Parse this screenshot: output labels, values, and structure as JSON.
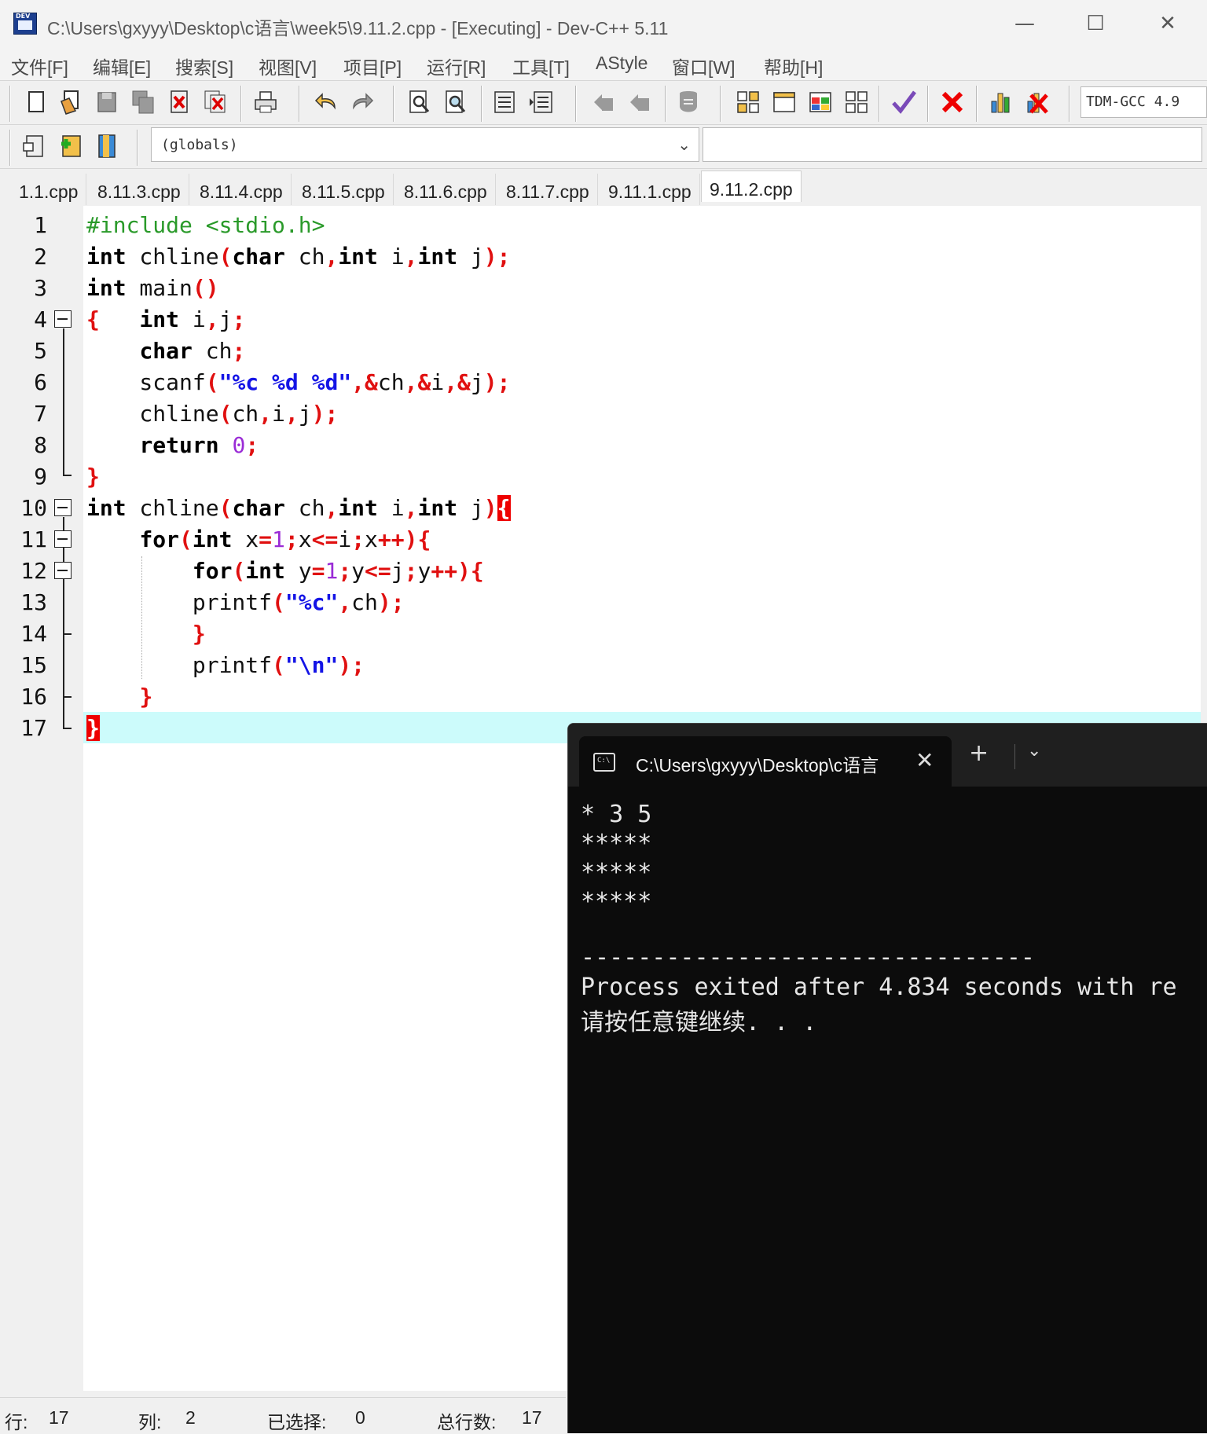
{
  "window": {
    "title": "C:\\Users\\gxyyy\\Desktop\\c语言\\week5\\9.11.2.cpp - [Executing] - Dev-C++ 5.11",
    "minimize": "—",
    "maximize": "☐",
    "close": "✕"
  },
  "menu": [
    "文件[F]",
    "编辑[E]",
    "搜索[S]",
    "视图[V]",
    "项目[P]",
    "运行[R]",
    "工具[T]",
    "AStyle",
    "窗口[W]",
    "帮助[H]"
  ],
  "toolbar": {
    "compiler": "TDM-GCC 4.9",
    "scope_combo": "(globals)"
  },
  "tabs": [
    "1.1.cpp",
    "8.11.3.cpp",
    "8.11.4.cpp",
    "8.11.5.cpp",
    "8.11.6.cpp",
    "8.11.7.cpp",
    "9.11.1.cpp",
    "9.11.2.cpp"
  ],
  "active_tab": "9.11.2.cpp",
  "editor": {
    "line_numbers": [
      "1",
      "2",
      "3",
      "4",
      "5",
      "6",
      "7",
      "8",
      "9",
      "10",
      "11",
      "12",
      "13",
      "14",
      "15",
      "16",
      "17"
    ],
    "lines": [
      "#include <stdio.h>",
      "int chline(char ch,int i,int j);",
      "int main()",
      "{   int i,j;",
      "    char ch;",
      "    scanf(\"%c %d %d\",&ch,&i,&j);",
      "    chline(ch,i,j);",
      "    return 0;",
      "}",
      "int chline(char ch,int i,int j){",
      "    for(int x=1;x<=i;x++){",
      "        for(int y=1;y<=j;y++){",
      "        printf(\"%c\",ch);",
      "        }",
      "        printf(\"\\n\");",
      "    }",
      "}"
    ],
    "current_line": 17
  },
  "status": {
    "row_label": "行:",
    "row_value": "17",
    "col_label": "列:",
    "col_value": "2",
    "sel_label": "已选择:",
    "sel_value": "0",
    "total_label": "总行数:",
    "total_value": "17"
  },
  "terminal": {
    "tab_title": "C:\\Users\\gxyyy\\Desktop\\c语言",
    "close": "✕",
    "new_tab": "+",
    "dropdown": "⌄",
    "output": [
      "* 3 5",
      "*****",
      "*****",
      "*****",
      "",
      "--------------------------------",
      "Process exited after 4.834 seconds with re",
      "请按任意键继续. . ."
    ]
  }
}
